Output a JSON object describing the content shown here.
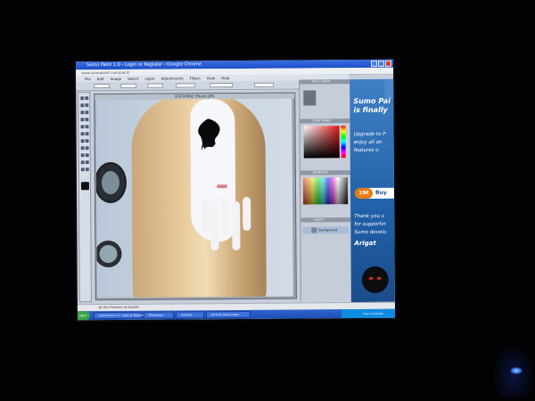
{
  "window": {
    "title": "Sumo Paint 1.0 - Login or Register - Google Chrome",
    "address": "www.sumopaint.com/paint/"
  },
  "menu": [
    "File",
    "Edit",
    "Image",
    "Select",
    "Layer",
    "Adjustments",
    "Filters",
    "View",
    "Help"
  ],
  "upgrade_label": "Upgrade to Pro",
  "canvas": {
    "title": "DSC00962 (Stunt).JPG"
  },
  "panels": {
    "navigator": "Info / Zoom",
    "color": "Color Picker",
    "swatches": "Swatches",
    "layers": "Layers",
    "layer_name": "Background"
  },
  "ad": {
    "title_line1": "Sumo Pai",
    "title_line2": "is finally",
    "body_lines": [
      "Upgrade to P",
      "enjoy all an",
      "features o"
    ],
    "price": "19€",
    "buy": "Buy",
    "thanks_lines": [
      "Thank you s",
      "for supportin",
      "Sumo develo",
      "Arigat"
    ]
  },
  "status": {
    "text": "At this Element of Doodle"
  },
  "taskbar": {
    "start": "start",
    "items": [
      "Sumo Paint 1.0 - Login or Register",
      "Photoshop",
      "Untitled",
      "All Funk Sticks Index"
    ],
    "tray": "Scan Computer"
  },
  "colors": {
    "accent": "#2160a8",
    "price": "#e87a12"
  }
}
